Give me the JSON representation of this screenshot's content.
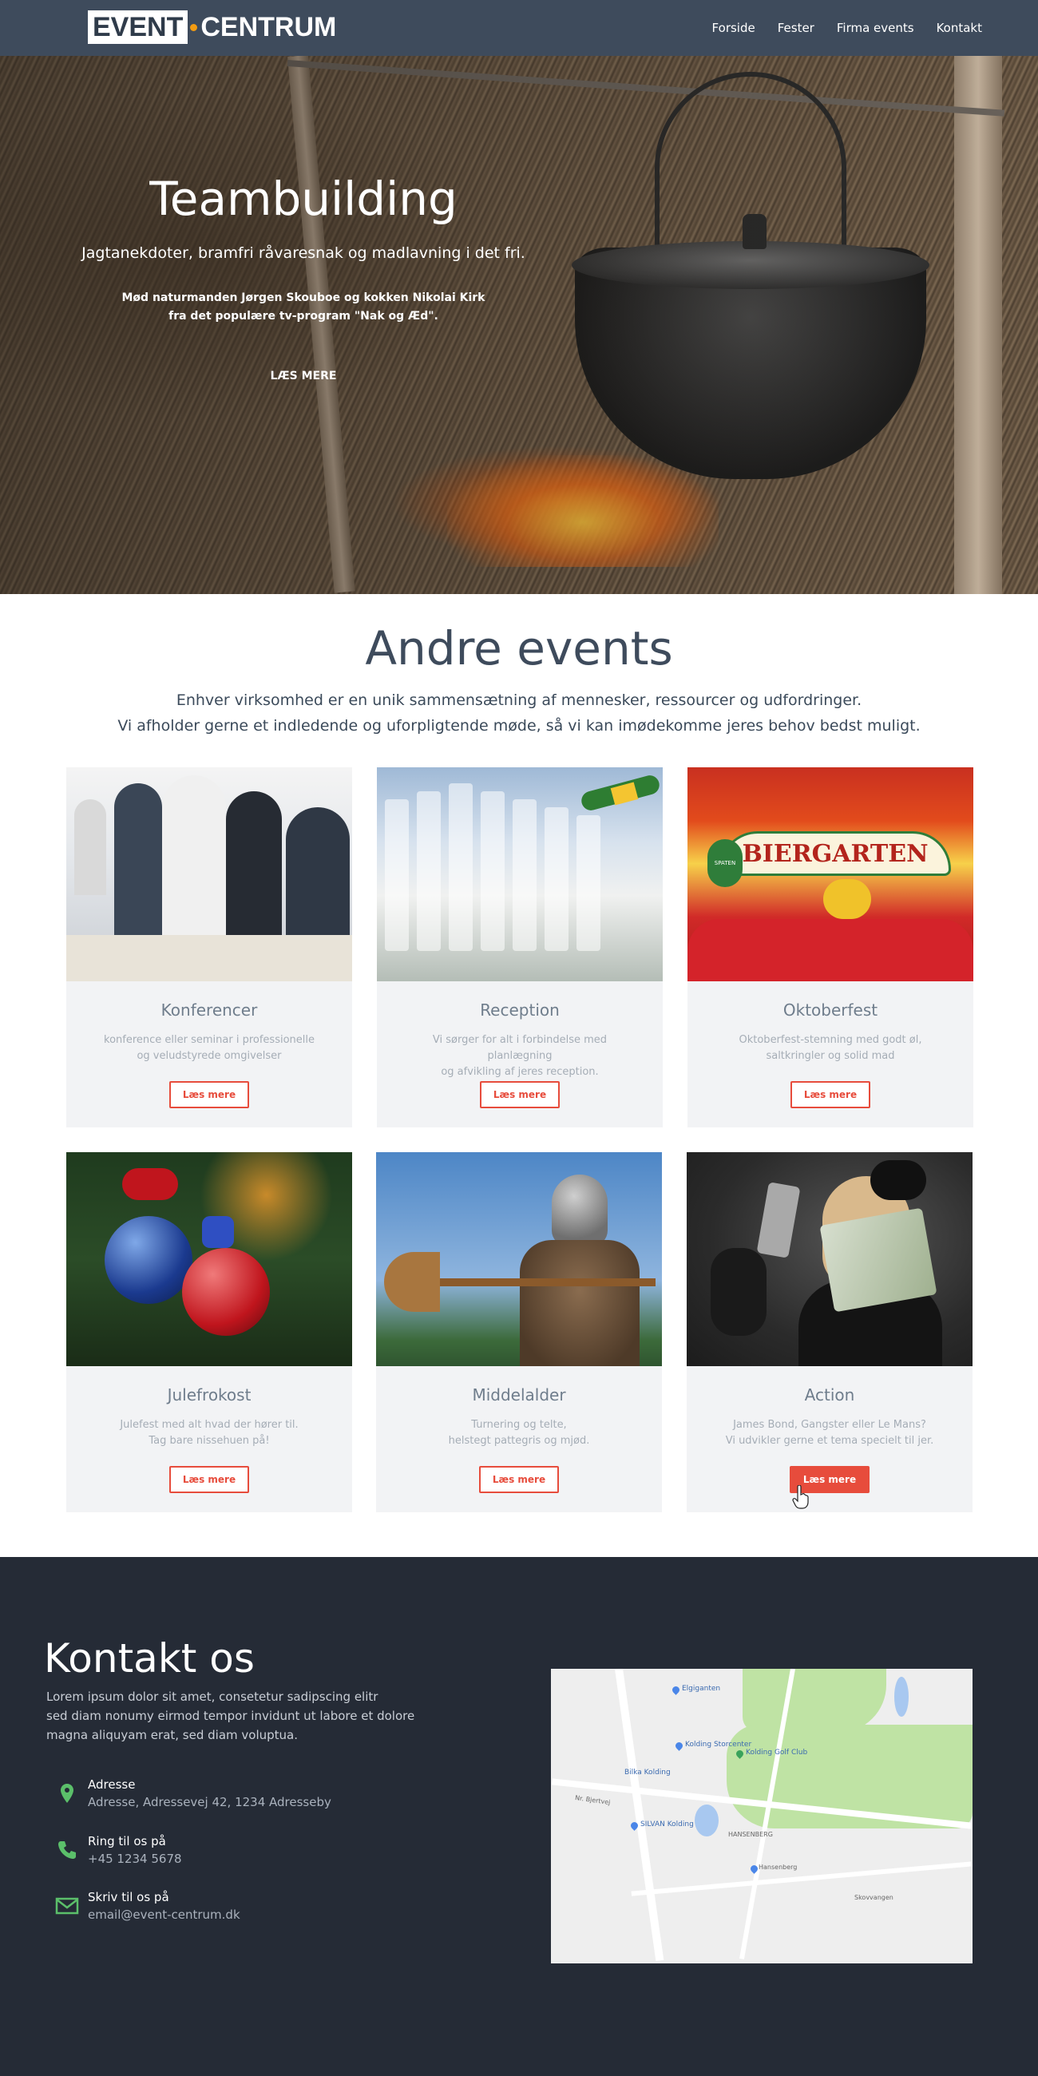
{
  "nav": {
    "logo_part1": "EVENT",
    "logo_part2": "CENTRUM",
    "links": [
      "Forside",
      "Fester",
      "Firma events",
      "Kontakt"
    ]
  },
  "hero": {
    "title": "Teambuilding",
    "subtitle": "Jagtanekdoter, bramfri råvaresnak og madlavning i det fri.",
    "desc_line1": "Mød naturmanden Jørgen Skouboe og kokken Nikolai Kirk",
    "desc_line2": "fra det populære tv-program \"Nak og Æd\".",
    "button": "LÆS MERE"
  },
  "events": {
    "title": "Andre events",
    "intro_line1": "Enhver virksomhed er en unik sammensætning af mennesker, ressourcer og udfordringer.",
    "intro_line2": "Vi afholder gerne et indledende og uforpligtende møde, så vi kan imødekomme jeres behov bedst muligt.",
    "cards": [
      {
        "title": "Konferencer",
        "text1": "konference eller seminar i professionelle",
        "text2": "og veludstyrede omgivelser",
        "button": "Læs mere"
      },
      {
        "title": "Reception",
        "text1": "Vi sørger for alt i forbindelse med planlægning",
        "text2": "og afvikling af jeres reception.",
        "button": "Læs mere"
      },
      {
        "title": "Oktoberfest",
        "text1": "Oktoberfest-stemning med godt øl,",
        "text2": "saltkringler og solid mad",
        "button": "Læs mere"
      },
      {
        "title": "Julefrokost",
        "text1": "Julefest med alt hvad der hører til.",
        "text2": "Tag bare nissehuen på!",
        "button": "Læs mere"
      },
      {
        "title": "Middelalder",
        "text1": "Turnering og telte,",
        "text2": "helstegt pattegris og mjød.",
        "button": "Læs mere"
      },
      {
        "title": "Action",
        "text1": "James Bond, Gangster eller  Le Mans?",
        "text2": "Vi udvikler gerne et tema specielt til jer.",
        "button": "Læs mere"
      }
    ],
    "oktober_sign": "BIERGARTEN",
    "oktober_brand": "SPATEN"
  },
  "contact": {
    "title": "Kontakt os",
    "lead1": "Lorem ipsum dolor sit amet, consetetur sadipscing elitr",
    "lead2": "sed diam nonumy eirmod tempor invidunt ut labore et dolore",
    "lead3": "magna aliquyam erat, sed diam voluptua.",
    "items": [
      {
        "label": "Adresse",
        "value": "Adresse, Adressevej 42, 1234 Adresseby",
        "icon": "map-pin-icon"
      },
      {
        "label": "Ring til os på",
        "value": "+45 1234 5678",
        "icon": "phone-icon"
      },
      {
        "label": "Skriv til os på",
        "value": "email@event-centrum.dk",
        "icon": "envelope-icon"
      }
    ],
    "icon_color": "#5bbf6a"
  },
  "map": {
    "labels": [
      "Elgiganten",
      "Kolding Storcenter",
      "Bilka Kolding",
      "Kolding Golf Club",
      "SILVAN Kolding",
      "HANSENBERG",
      "Hansenberg",
      "Skovvangen",
      "Nr. Bjertvej"
    ]
  }
}
